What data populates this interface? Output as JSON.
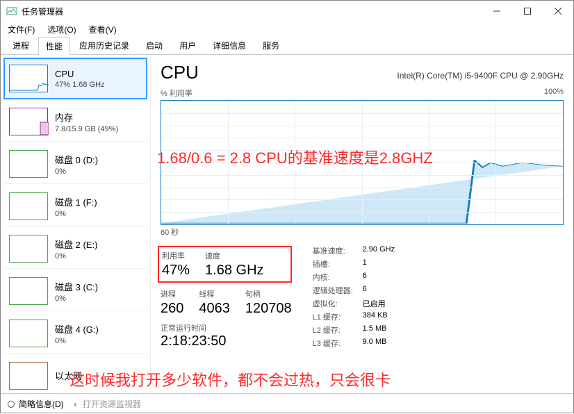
{
  "window": {
    "title": "任务管理器"
  },
  "menu": {
    "file": "文件(F)",
    "options": "选项(O)",
    "view": "查看(V)"
  },
  "tabs": [
    "进程",
    "性能",
    "应用历史记录",
    "启动",
    "用户",
    "详细信息",
    "服务"
  ],
  "sidebar": {
    "items": [
      {
        "label": "CPU",
        "sub": "47% 1.68 GHz",
        "type": "cpu"
      },
      {
        "label": "内存",
        "sub": "7.8/15.9 GB (49%)",
        "type": "mem"
      },
      {
        "label": "磁盘 0 (D:)",
        "sub": "0%",
        "type": "disk"
      },
      {
        "label": "磁盘 1 (F:)",
        "sub": "0%",
        "type": "disk"
      },
      {
        "label": "磁盘 2 (E:)",
        "sub": "0%",
        "type": "disk"
      },
      {
        "label": "磁盘 3 (C:)",
        "sub": "0%",
        "type": "disk"
      },
      {
        "label": "磁盘 4 (G:)",
        "sub": "0%",
        "type": "disk"
      },
      {
        "label": "以太网",
        "sub": "",
        "type": "net"
      }
    ]
  },
  "main": {
    "title": "CPU",
    "model": "Intel(R) Core(TM) i5-9400F CPU @ 2.90GHz",
    "util_label": "% 利用率",
    "util_max": "100%",
    "time_label": "60 秒",
    "stats_head": {
      "util": "利用率",
      "speed": "速度"
    },
    "stats_val": {
      "util": "47%",
      "speed": "1.68 GHz"
    },
    "procs_head": {
      "proc": "进程",
      "threads": "线程",
      "handles": "句柄"
    },
    "procs_val": {
      "proc": "260",
      "threads": "4063",
      "handles": "120708"
    },
    "uptime_label": "正常运行时间",
    "uptime": "2:18:23:50",
    "pairs": [
      {
        "lab": "基准速度:",
        "val": "2.90 GHz"
      },
      {
        "lab": "插槽:",
        "val": "1"
      },
      {
        "lab": "内核:",
        "val": "6"
      },
      {
        "lab": "逻辑处理器:",
        "val": "6"
      },
      {
        "lab": "虚拟化:",
        "val": "已启用"
      },
      {
        "lab": "L1 缓存:",
        "val": "384 KB"
      },
      {
        "lab": "L2 缓存:",
        "val": "1.5 MB"
      },
      {
        "lab": "L3 缓存:",
        "val": "9.0 MB"
      }
    ]
  },
  "footer": {
    "brief": "简略信息(D)",
    "resmon": "打开资源监视器"
  },
  "annotations": {
    "line1": "1.68/0.6 = 2.8 CPU的基准速度是2.8GHZ",
    "line2": "这时候我打开多少软件，都不会过热，只会很卡"
  },
  "chart_data": {
    "type": "line",
    "title": "% 利用率",
    "xlabel": "60 秒",
    "ylabel": "",
    "ylim": [
      0,
      100
    ],
    "x_seconds": [
      60,
      55,
      50,
      45,
      40,
      35,
      30,
      25,
      20,
      15,
      10,
      5,
      0
    ],
    "series": [
      {
        "name": "CPU 利用率",
        "values": [
          0,
          0,
          0,
          0,
          0,
          0,
          0,
          0,
          0,
          52,
          46,
          50,
          48,
          47
        ]
      }
    ]
  }
}
